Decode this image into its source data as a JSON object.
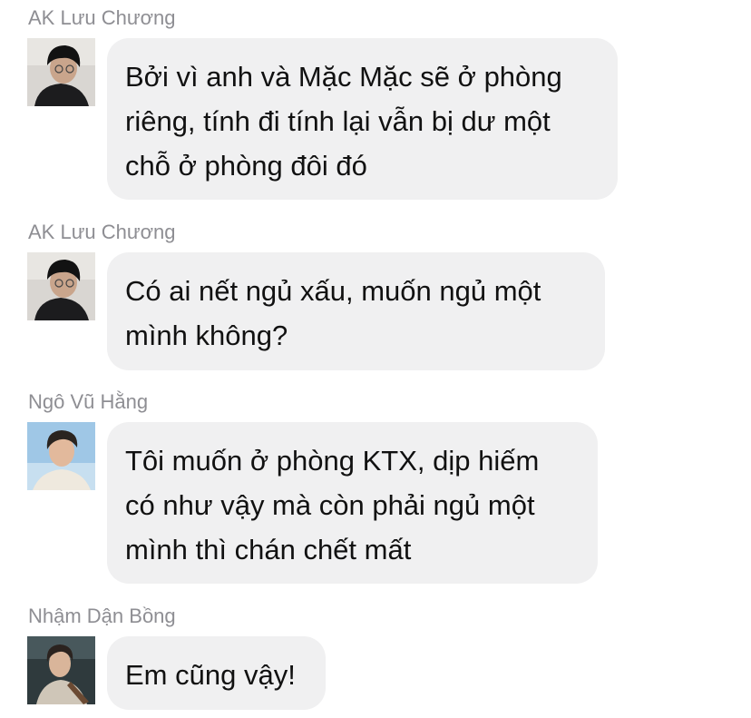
{
  "messages": [
    {
      "sender": "AK Lưu Chương",
      "lines": [
        "Bởi vì anh và Mặc Mặc sẽ ở phòng",
        "riêng, tính đi tính lại vẫn bị dư một",
        "chỗ ở phòng đôi đó"
      ]
    },
    {
      "sender": "AK Lưu Chương",
      "lines": [
        "Có ai nết ngủ xấu, muốn ngủ một",
        "mình không?"
      ]
    },
    {
      "sender": "Ngô Vũ Hằng",
      "lines": [
        "Tôi muốn ở phòng KTX, dịp hiếm",
        "có như vậy mà còn phải ngủ một",
        "mình thì chán chết mất"
      ]
    },
    {
      "sender": "Nhậm Dận Bồng",
      "lines": [
        "Em cũng vậy!"
      ]
    }
  ],
  "colors": {
    "bubble": "#f0f0f1",
    "name": "#8e8e93",
    "text": "#111111"
  }
}
